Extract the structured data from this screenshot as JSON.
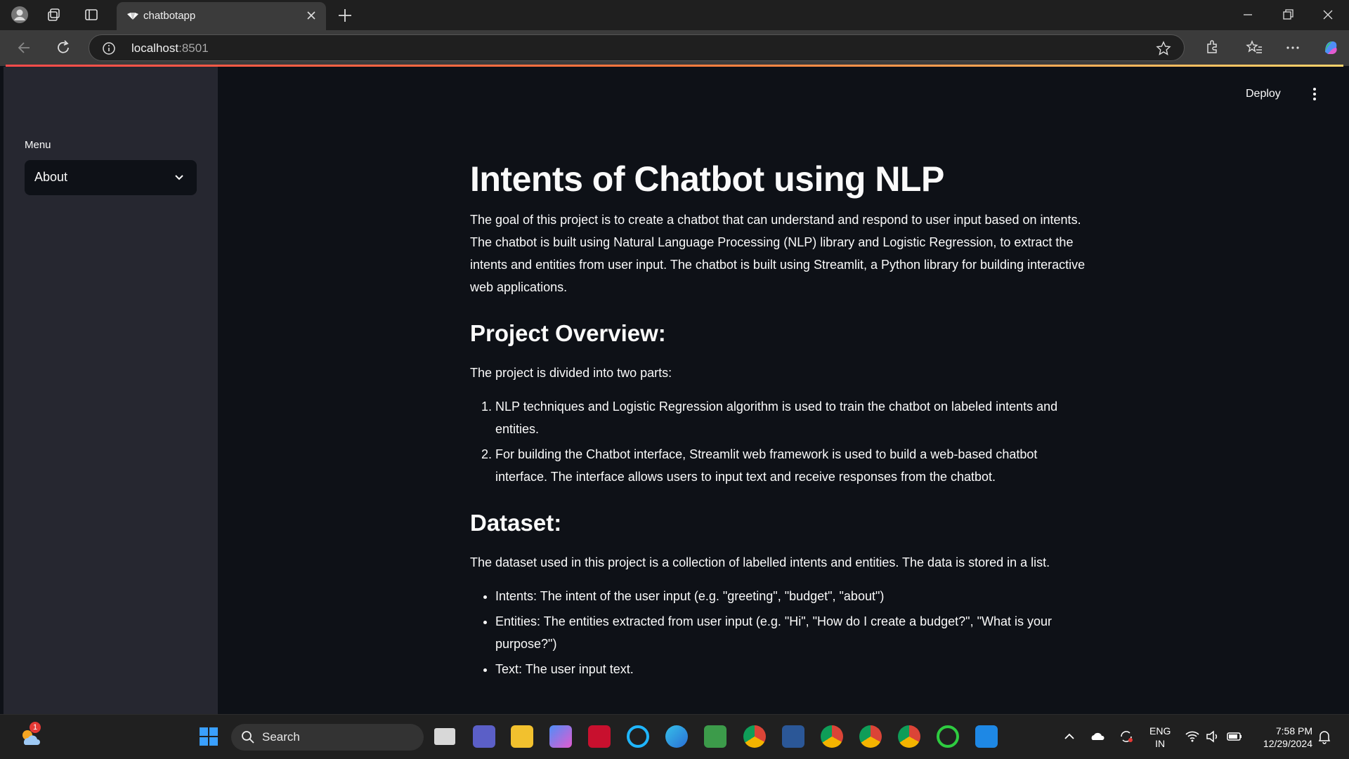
{
  "browser": {
    "tab_title": "chatbotapp",
    "url_host": "localhost",
    "url_port": ":8501"
  },
  "sidebar": {
    "menu_label": "Menu",
    "select_value": "About"
  },
  "header": {
    "deploy_label": "Deploy"
  },
  "main": {
    "title": "Intents of Chatbot using NLP",
    "intro": "The goal of this project is to create a chatbot that can understand and respond to user input based on intents. The chatbot is built using Natural Language Processing (NLP) library and Logistic Regression, to extract the intents and entities from user input. The chatbot is built using Streamlit, a Python library for building interactive web applications.",
    "overview_heading": "Project Overview:",
    "overview_text": "The project is divided into two parts:",
    "overview_items": [
      "NLP techniques and Logistic Regression algorithm is used to train the chatbot on labeled intents and entities.",
      "For building the Chatbot interface, Streamlit web framework is used to build a web-based chatbot interface. The interface allows users to input text and receive responses from the chatbot."
    ],
    "dataset_heading": "Dataset:",
    "dataset_text": "The dataset used in this project is a collection of labelled intents and entities. The data is stored in a list.",
    "dataset_items": [
      "Intents: The intent of the user input (e.g. \"greeting\", \"budget\", \"about\")",
      "Entities: The entities extracted from user input (e.g. \"Hi\", \"How do I create a budget?\", \"What is your purpose?\")",
      "Text: The user input text."
    ]
  },
  "taskbar": {
    "search_label": "Search",
    "weather_badge": "1",
    "lang_line1": "ENG",
    "lang_line2": "IN",
    "time": "7:58 PM",
    "date": "12/29/2024"
  },
  "colors": {
    "app_bg": "#0e1117",
    "sidebar_bg": "#262730",
    "text": "#fafafa",
    "accent": "#ff4b4b"
  }
}
